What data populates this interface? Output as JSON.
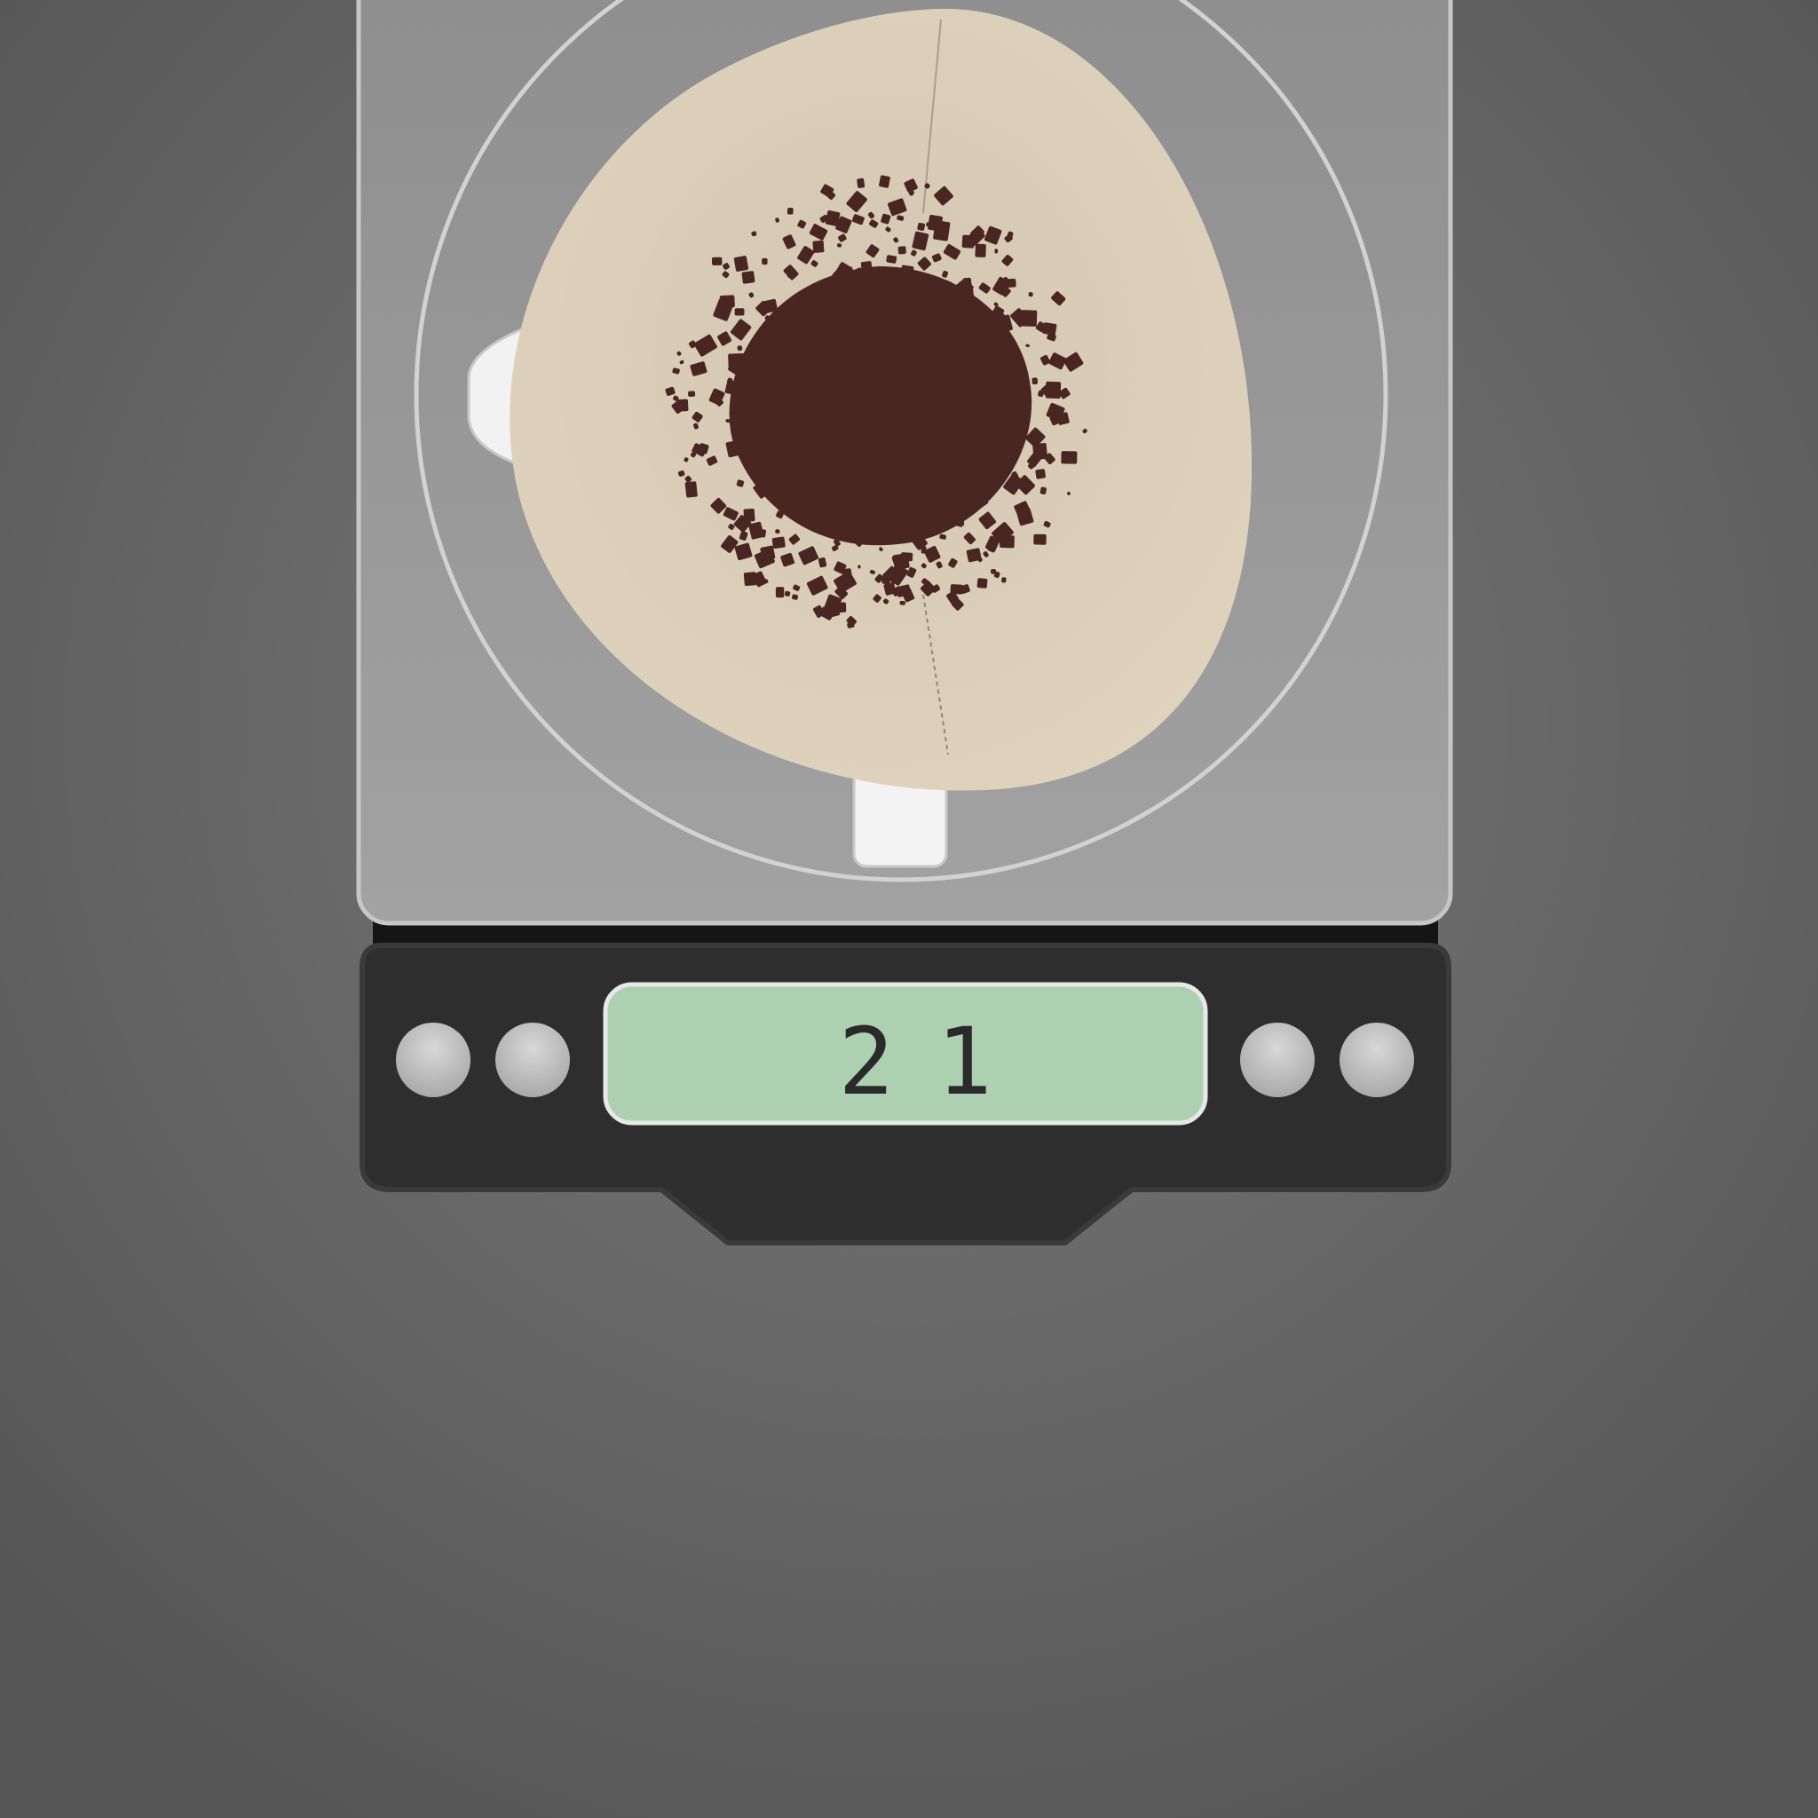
{
  "scale": {
    "display_readout": "21",
    "buttons": [
      {
        "name": "left-button-1"
      },
      {
        "name": "left-button-2"
      },
      {
        "name": "right-button-1"
      },
      {
        "name": "right-button-2"
      }
    ]
  },
  "colors": {
    "background": "#5a5a5a",
    "platform": "#9a9a9a",
    "platform_ring": "#d2d2d2",
    "filter_paper": "#dccfb9",
    "coffee_grounds": "#4a2622",
    "scale_base": "#2e2e2e",
    "display_lcd": "#acd0b0",
    "display_digits": "#2a2a2a",
    "button": "#cfcfcf"
  },
  "icons": {
    "dripper": "pour-over-dripper-icon",
    "grounds": "coffee-grounds-icon"
  }
}
